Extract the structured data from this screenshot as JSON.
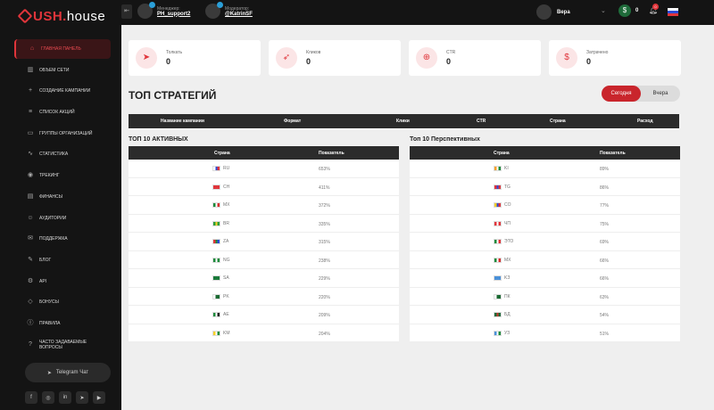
{
  "app": {
    "logo_prefix": "USH",
    "logo_dot": ".",
    "logo_suffix": "house"
  },
  "topbar": {
    "manager_role": "Менеджер:",
    "manager_handle": "PH_support2",
    "moderator_role": "Модератор:",
    "moderator_handle": "@KatrinSF",
    "user_name": "Вера",
    "balance": "0",
    "notifications": "0"
  },
  "sidebar": {
    "items": [
      {
        "label": "Главная панель",
        "icon": "home-icon",
        "glyph": "⌂"
      },
      {
        "label": "Объем сети",
        "icon": "chart-icon",
        "glyph": "▥"
      },
      {
        "label": "Создание кампании",
        "icon": "plus-icon",
        "glyph": "+"
      },
      {
        "label": "Список акций",
        "icon": "list-icon",
        "glyph": "≡"
      },
      {
        "label": "Группы организаций",
        "icon": "folder-icon",
        "glyph": "▭"
      },
      {
        "label": "Статистика",
        "icon": "stats-icon",
        "glyph": "∿"
      },
      {
        "label": "Трекинг",
        "icon": "eye-icon",
        "glyph": "◉"
      },
      {
        "label": "Финансы",
        "icon": "card-icon",
        "glyph": "▤"
      },
      {
        "label": "Аудитории",
        "icon": "audience-icon",
        "glyph": "☺"
      },
      {
        "label": "Поддержка",
        "icon": "support-icon",
        "glyph": "✉"
      },
      {
        "label": "Блог",
        "icon": "blog-icon",
        "glyph": "✎"
      },
      {
        "label": "API",
        "icon": "api-icon",
        "glyph": "⚙"
      },
      {
        "label": "Бонусы",
        "icon": "bonus-icon",
        "glyph": "◇"
      },
      {
        "label": "Правила",
        "icon": "info-icon",
        "glyph": "ⓘ"
      },
      {
        "label": "Часто задаваемые вопросы",
        "icon": "question-icon",
        "glyph": "?"
      }
    ],
    "telegram_label": "Telegram Чат",
    "socials": [
      {
        "name": "facebook-icon",
        "glyph": "f"
      },
      {
        "name": "instagram-icon",
        "glyph": "◎"
      },
      {
        "name": "linkedin-icon",
        "glyph": "in"
      },
      {
        "name": "telegram-icon",
        "glyph": "➤"
      },
      {
        "name": "youtube-icon",
        "glyph": "▶"
      }
    ]
  },
  "stats": [
    {
      "label": "Толкать",
      "value": "0",
      "icon": "send-icon",
      "glyph": "➤"
    },
    {
      "label": "Кликов",
      "value": "0",
      "icon": "cursor-icon",
      "glyph": "➶"
    },
    {
      "label": "CTR",
      "value": "0",
      "icon": "target-icon",
      "glyph": "⊕"
    },
    {
      "label": "Затрачено",
      "value": "0",
      "icon": "dollar-icon",
      "glyph": "$"
    }
  ],
  "strategies": {
    "title": "ТОП СТРАТЕГИЙ",
    "toggle_today": "Сегодня",
    "toggle_yesterday": "Вчера",
    "columns": [
      "Название кампании",
      "Формат",
      "Клики",
      "CTR",
      "Страна",
      "Расход"
    ]
  },
  "active": {
    "title": "ТОП 10 АКТИВНЫХ",
    "col_country": "Страна",
    "col_value": "Показатель",
    "rows": [
      {
        "code": "RU",
        "value": "653%",
        "flag": [
          "#ffffff",
          "#2c4bd8",
          "#e0353b"
        ]
      },
      {
        "code": "CH",
        "value": "411%",
        "flag": [
          "#e0353b",
          "#e0353b",
          "#e0353b"
        ]
      },
      {
        "code": "MX",
        "value": "372%",
        "flag": [
          "#1a8a3a",
          "#ffffff",
          "#d62f2f"
        ]
      },
      {
        "code": "BR",
        "value": "335%",
        "flag": [
          "#2a9d3a",
          "#f5d02a",
          "#2a9d3a"
        ]
      },
      {
        "code": "ZA",
        "value": "315%",
        "flag": [
          "#e0353b",
          "#1a8a3a",
          "#2c4bd8"
        ]
      },
      {
        "code": "NG",
        "value": "238%",
        "flag": [
          "#1a8a3a",
          "#ffffff",
          "#1a8a3a"
        ]
      },
      {
        "code": "SA",
        "value": "229%",
        "flag": [
          "#1a7a3a",
          "#1a7a3a",
          "#1a7a3a"
        ]
      },
      {
        "code": "PK",
        "value": "220%",
        "flag": [
          "#ffffff",
          "#1a6a32",
          "#1a6a32"
        ]
      },
      {
        "code": "AE",
        "value": "209%",
        "flag": [
          "#1a8a3a",
          "#ffffff",
          "#222222"
        ]
      },
      {
        "code": "KM",
        "value": "204%",
        "flag": [
          "#f5d02a",
          "#ffffff",
          "#1a8a3a"
        ]
      }
    ]
  },
  "prospective": {
    "title": "Топ 10 Перспективных",
    "col_country": "Страна",
    "col_value": "Показатель",
    "rows": [
      {
        "code": "KI",
        "value": "89%",
        "flag": [
          "#f5a02a",
          "#ffffff",
          "#1a8a3a"
        ]
      },
      {
        "code": "TG",
        "value": "86%",
        "flag": [
          "#e0353b",
          "#2c4bd8",
          "#e0353b"
        ]
      },
      {
        "code": "CO",
        "value": "77%",
        "flag": [
          "#f5d02a",
          "#2c4bd8",
          "#e0353b"
        ]
      },
      {
        "code": "ЧП",
        "value": "75%",
        "flag": [
          "#e0353b",
          "#ffffff",
          "#e0353b"
        ]
      },
      {
        "code": "ЭТО",
        "value": "69%",
        "flag": [
          "#1a8a3a",
          "#ffffff",
          "#e0353b"
        ]
      },
      {
        "code": "MX",
        "value": "66%",
        "flag": [
          "#1a8a3a",
          "#ffffff",
          "#d62f2f"
        ]
      },
      {
        "code": "KЗ",
        "value": "66%",
        "flag": [
          "#4a90d9",
          "#4a90d9",
          "#4a90d9"
        ]
      },
      {
        "code": "ПК",
        "value": "63%",
        "flag": [
          "#ffffff",
          "#1a6a32",
          "#1a6a32"
        ]
      },
      {
        "code": "БД",
        "value": "54%",
        "flag": [
          "#1a6a3a",
          "#c0392b",
          "#1a6a3a"
        ]
      },
      {
        "code": "УЗ",
        "value": "51%",
        "flag": [
          "#4a90d9",
          "#ffffff",
          "#1a8a3a"
        ]
      }
    ]
  },
  "colors": {
    "accent": "#e0353b",
    "dark": "#141414",
    "table_head": "#2b2b2b"
  }
}
